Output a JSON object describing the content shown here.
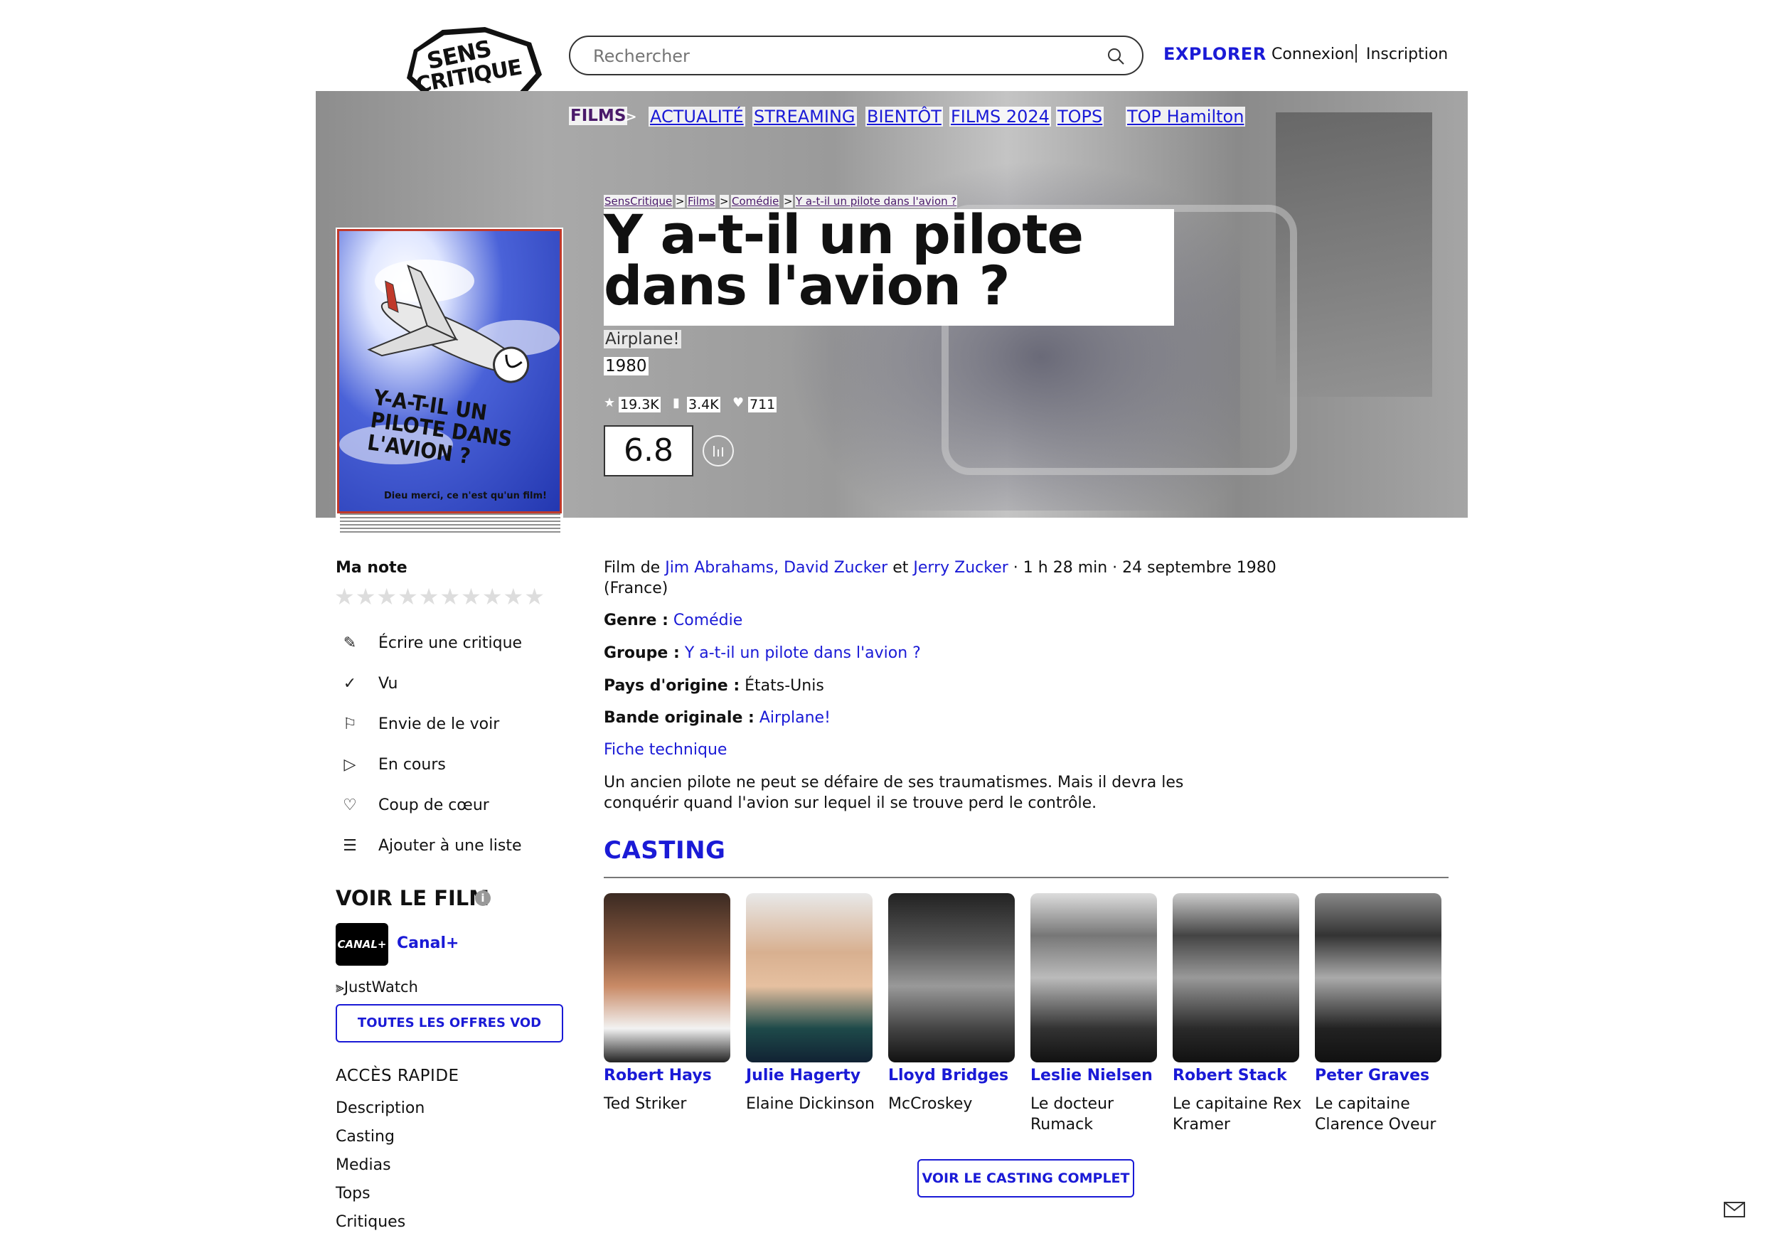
{
  "header": {
    "logo_line1": "SENS",
    "logo_line2": "CRITIQUE",
    "search_placeholder": "Rechercher",
    "explorer": "EXPLORER",
    "connexion": "Connexion",
    "inscription": "Inscription"
  },
  "nav": {
    "films": "FILMS",
    "chevron": ">",
    "items": [
      "ACTUALITÉ",
      "STREAMING",
      "BIENTÔT",
      "FILMS 2024",
      "TOPS"
    ],
    "separator": "|",
    "top_hamilton": "TOP Hamilton"
  },
  "breadcrumb": [
    "SensCritique",
    "Films",
    "Comédie",
    "Y a-t-il un pilote dans l'avion ?"
  ],
  "breadcrumb_sep": ">",
  "film": {
    "title": "Y a-t-il un pilote dans l'avion ?",
    "original_title": "Airplane!",
    "year": "1980",
    "stats": {
      "ratings": "19.3K",
      "wishlist": "3.4K",
      "favorites": "711"
    },
    "rating": "6.8",
    "poster_text": "Y-A-T-IL UN PILOTE DANS L'AVION ?",
    "poster_tagline": "Dieu merci, ce n'est qu'un film!"
  },
  "sidebar": {
    "ma_note": "Ma note",
    "stars": "★★★★★★★★★★",
    "actions": [
      {
        "icon": "pencil-icon",
        "glyph": "✎",
        "label": "Écrire une critique"
      },
      {
        "icon": "check-icon",
        "glyph": "✓",
        "label": "Vu"
      },
      {
        "icon": "bookmark-icon",
        "glyph": "⚐",
        "label": "Envie de le voir"
      },
      {
        "icon": "play-icon",
        "glyph": "▷",
        "label": "En cours"
      },
      {
        "icon": "heart-icon",
        "glyph": "♡",
        "label": "Coup de cœur"
      },
      {
        "icon": "list-add-icon",
        "glyph": "☰",
        "label": "Ajouter à une liste"
      }
    ],
    "voir_le_film": "VOIR LE FILM",
    "info_glyph": "i",
    "provider_logo": "CANAL+",
    "provider_name": "Canal+",
    "justwatch": "JustWatch",
    "vod_button": "TOUTES LES OFFRES VOD",
    "acces_rapide": "ACCÈS RAPIDE",
    "quick_links": [
      "Description",
      "Casting",
      "Medias",
      "Tops",
      "Critiques"
    ]
  },
  "details": {
    "film_de_prefix": "Film de",
    "director1": "Jim Abrahams, David Zucker",
    "et": "et",
    "director2": "Jerry Zucker",
    "duration_date": "· 1 h 28 min · 24 septembre 1980",
    "country_note": "(France)",
    "genre_label": "Genre :",
    "genre_value": "Comédie",
    "groupe_label": "Groupe :",
    "groupe_value": "Y a-t-il un pilote dans l'avion ?",
    "pays_label": "Pays d'origine :",
    "pays_value": "États-Unis",
    "bande_label": "Bande originale :",
    "bande_value": "Airplane!",
    "fiche": "Fiche technique",
    "synopsis": "Un ancien pilote ne peut se défaire de ses traumatismes. Mais il devra les conquérir quand l'avion sur lequel il se trouve perd le contrôle."
  },
  "casting": {
    "title": "CASTING",
    "button": "VOIR LE CASTING COMPLET",
    "actors": [
      {
        "name": "Robert Hays",
        "role": "Ted Striker"
      },
      {
        "name": "Julie Hagerty",
        "role": "Elaine Dickinson"
      },
      {
        "name": "Lloyd Bridges",
        "role": "McCroskey"
      },
      {
        "name": "Leslie Nielsen",
        "role": "Le docteur Rumack"
      },
      {
        "name": "Robert Stack",
        "role": "Le capitaine Rex Kramer"
      },
      {
        "name": "Peter Graves",
        "role": "Le capitaine Clarence Oveur"
      }
    ]
  },
  "colors": {
    "accent": "#1a1ad6",
    "films_nav": "#4a1a6a"
  }
}
